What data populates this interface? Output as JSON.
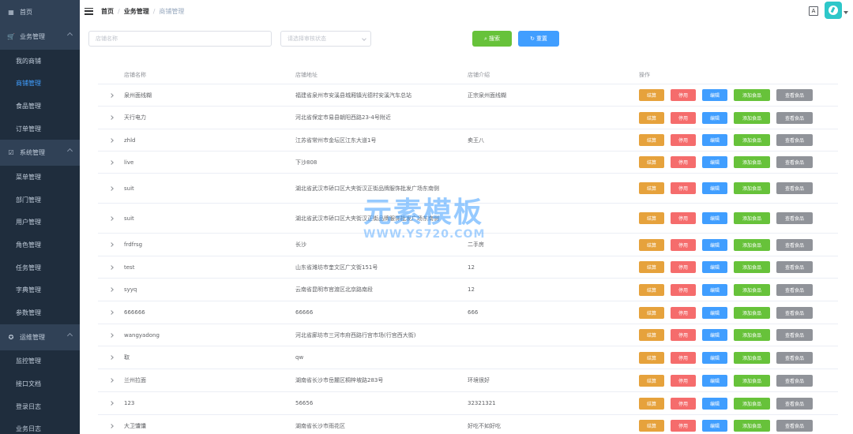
{
  "sidebar": {
    "home": {
      "icon": "dashboard-icon",
      "label": "首页"
    },
    "groups": [
      {
        "icon": "cart-icon",
        "label": "业务管理",
        "items": [
          "我的商铺",
          "商铺管理",
          "食品管理",
          "订单管理"
        ],
        "active": "商铺管理"
      },
      {
        "icon": "settings-icon",
        "label": "系统管理",
        "items": [
          "菜单管理",
          "部门管理",
          "用户管理",
          "角色管理",
          "任务管理",
          "字典管理",
          "参数管理"
        ]
      },
      {
        "icon": "monitor-icon",
        "label": "运维管理",
        "items": [
          "监控管理",
          "接口文档",
          "登录日志",
          "业务日志"
        ]
      }
    ],
    "accent": "#409eff"
  },
  "header": {
    "breadcrumb": [
      "首页",
      "业务管理",
      "商铺管理"
    ],
    "translate_icon": "A"
  },
  "search": {
    "name_placeholder": "店铺名称",
    "status_placeholder": "请选择审核状态",
    "search_label": "搜索",
    "reset_label": "重置"
  },
  "table": {
    "columns": [
      "店铺名称",
      "店铺地址",
      "店铺介绍",
      "操作"
    ],
    "actions": [
      "结算",
      "停用",
      "编辑",
      "添加食品",
      "查看食品"
    ],
    "action_colors": [
      "#e6a23c",
      "#f56c6c",
      "#409eff",
      "#67c23a",
      "#909399"
    ],
    "rows": [
      {
        "name": "泉州面线糊",
        "address": "福建省泉州市安溪县城厢镇光德村安溪汽车总站",
        "intro": "正宗泉州面线糊"
      },
      {
        "name": "天行电力",
        "address": "河北省保定市易县朝阳西路23-4号附近",
        "intro": ""
      },
      {
        "name": "zhld",
        "address": "江苏省常州市金坛区江东大道1号",
        "intro": "卖王八"
      },
      {
        "name": "live",
        "address": "下沙808",
        "intro": ""
      },
      {
        "name": "suit",
        "address": "湖北省武汉市硚口区大夹街汉正街品牌服饰批发广场东南侧",
        "intro": ""
      },
      {
        "name": "suit",
        "address": "湖北省武汉市硚口区大夹街汉正街品牌服饰批发广场东南侧",
        "intro": ""
      },
      {
        "name": "frdfrsg",
        "address": "长沙",
        "intro": "二手房"
      },
      {
        "name": "test",
        "address": "山东省潍坊市奎文区广文街151号",
        "intro": "12"
      },
      {
        "name": "syyq",
        "address": "云南省昆明市官渡区北京路南段",
        "intro": "12"
      },
      {
        "name": "666666",
        "address": "66666",
        "intro": "666"
      },
      {
        "name": "wangyadong",
        "address": "河北省廊坊市三河市府西路行宫市场(行宫西大街)",
        "intro": ""
      },
      {
        "name": "取",
        "address": "qw",
        "intro": ""
      },
      {
        "name": "兰州拉面",
        "address": "湖南省长沙市岳麓区桐梓坡路283号",
        "intro": "环境很好"
      },
      {
        "name": "123",
        "address": "56656",
        "intro": "32321321"
      },
      {
        "name": "大卫馕馕",
        "address": "湖南省长沙市雨花区",
        "intro": "好吃不如好吃"
      }
    ]
  },
  "watermark": {
    "title": "元素模板",
    "url": "WWW.YS720.COM"
  }
}
